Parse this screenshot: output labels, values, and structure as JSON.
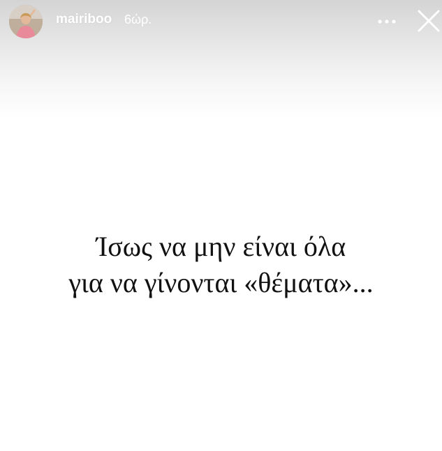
{
  "header": {
    "username": "mairiboo",
    "time_ago": "6ώρ.",
    "avatar_icon": "profile-avatar",
    "more_icon": "more-options-icon",
    "close_icon": "close-icon",
    "header_text_color": "#ffffff"
  },
  "story": {
    "line1": "Ίσως να μην είναι όλα",
    "line2": "για να γίνονται «θέματα»...",
    "background": "#ffffff",
    "text_color": "#111111"
  }
}
